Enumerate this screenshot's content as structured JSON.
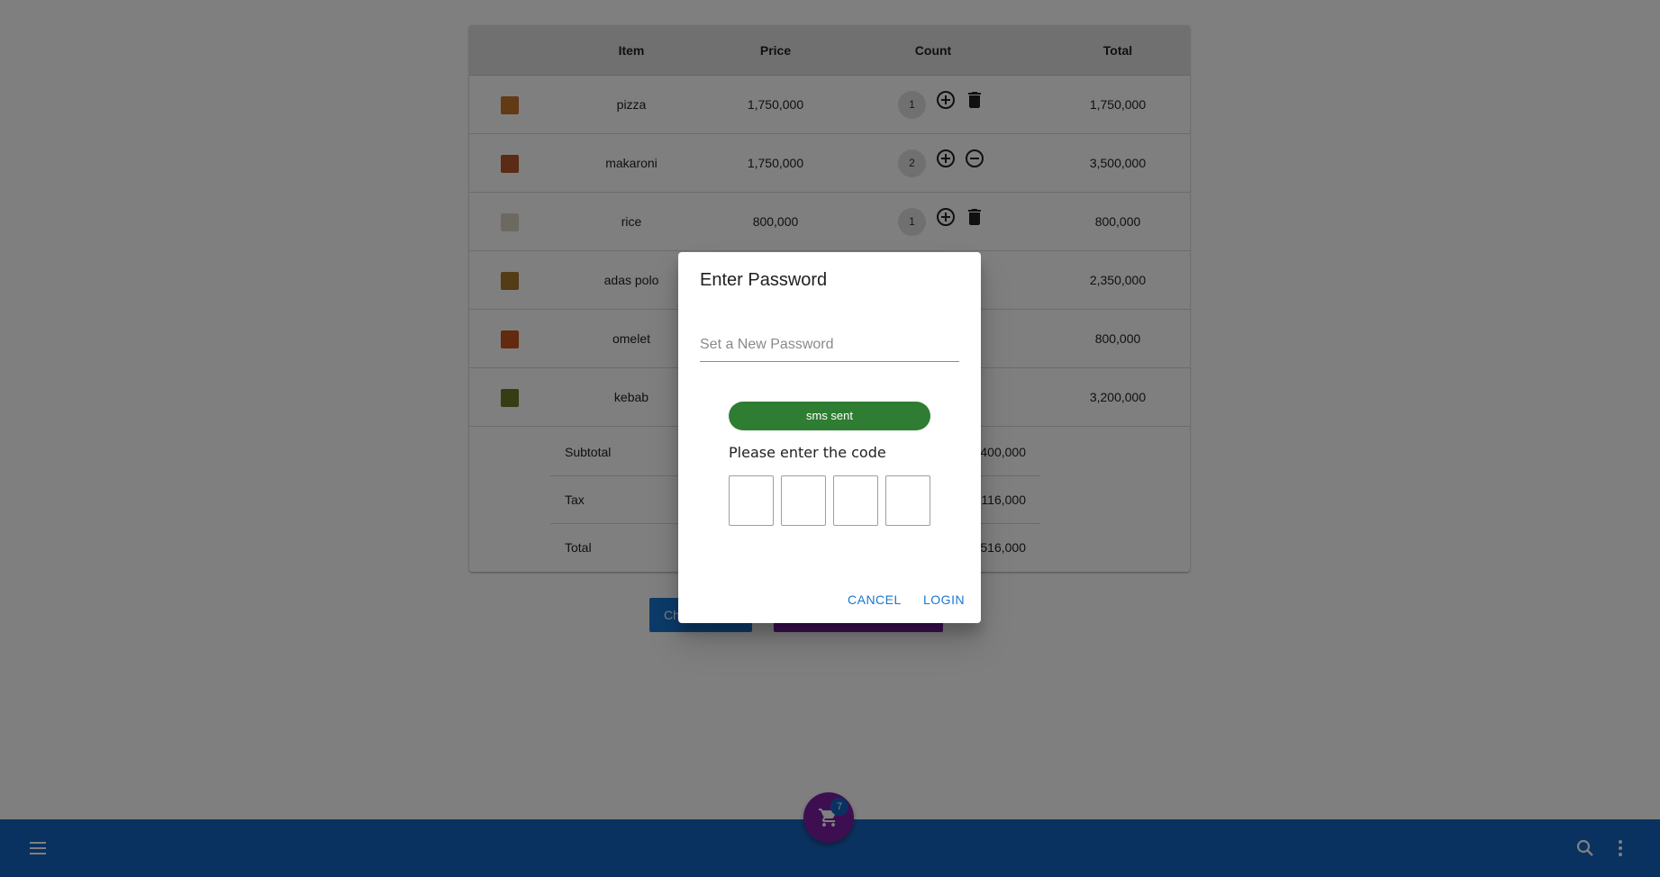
{
  "table": {
    "headers": {
      "item": "Item",
      "price": "Price",
      "count": "Count",
      "total": "Total"
    },
    "rows": [
      {
        "name": "pizza",
        "price": "1,750,000",
        "count": "1",
        "total": "1,750,000",
        "action_icon": "delete-icon",
        "thumb_color": "#c4742a"
      },
      {
        "name": "makaroni",
        "price": "1,750,000",
        "count": "2",
        "total": "3,500,000",
        "action_icon": "remove-circle-icon",
        "thumb_color": "#b5562a"
      },
      {
        "name": "rice",
        "price": "800,000",
        "count": "1",
        "total": "800,000",
        "action_icon": "delete-icon",
        "thumb_color": "#d9d4c0"
      },
      {
        "name": "adas polo",
        "price": "",
        "count": "",
        "total": "2,350,000",
        "action_icon": "",
        "thumb_color": "#a7782c"
      },
      {
        "name": "omelet",
        "price": "",
        "count": "",
        "total": "800,000",
        "action_icon": "",
        "thumb_color": "#c4551c"
      },
      {
        "name": "kebab",
        "price": "",
        "count": "",
        "total": "3,200,000",
        "action_icon": "",
        "thumb_color": "#6b7a2a"
      }
    ],
    "summary": [
      {
        "label": "Subtotal",
        "value": "400,000"
      },
      {
        "label": "Tax",
        "value": "116,000"
      },
      {
        "label": "Total",
        "value": "516,000"
      }
    ]
  },
  "actions": {
    "checkout_label": "Ch"
  },
  "appbar": {
    "cart_count": "7",
    "color": "#1565c0",
    "fab_color": "#7b1fa2"
  },
  "dialog": {
    "title": "Enter Password",
    "password_placeholder": "Set a New Password",
    "sms_status": "sms sent",
    "code_prompt": "Please enter the code",
    "code_values": [
      "",
      "",
      "",
      ""
    ],
    "cancel_label": "CANCEL",
    "login_label": "LOGIN",
    "status_color": "#2e7d32",
    "accent_color": "#1976d2"
  }
}
